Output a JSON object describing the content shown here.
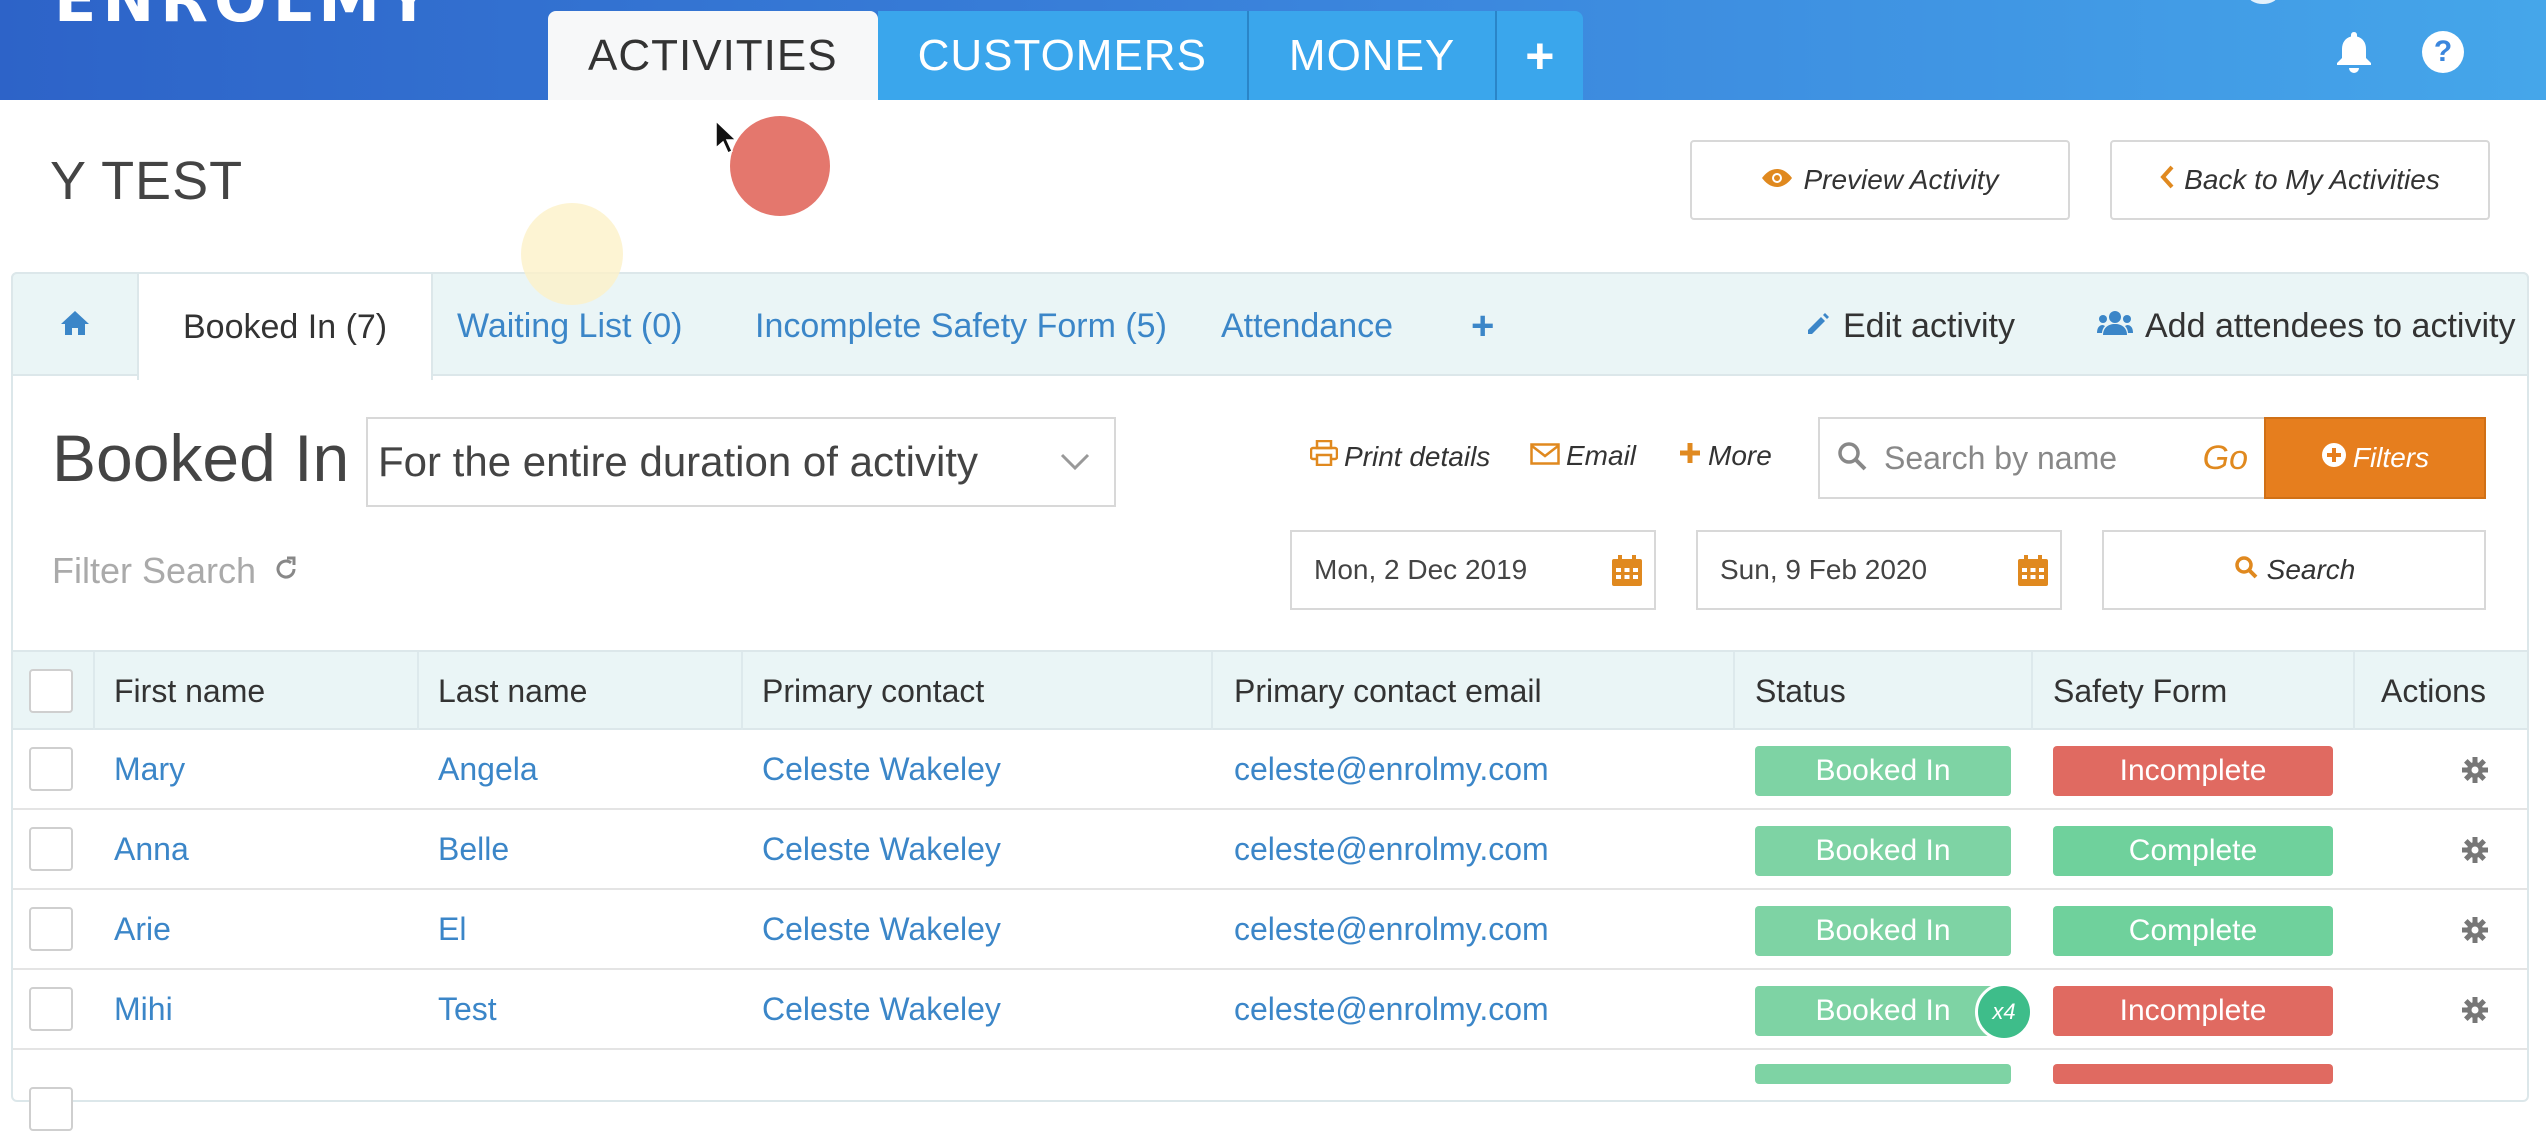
{
  "app": {
    "logo": "ENROLMY"
  },
  "nav": {
    "tabs": [
      {
        "label": "ACTIVITIES",
        "active": true
      },
      {
        "label": "CUSTOMERS",
        "active": false
      },
      {
        "label": "MONEY",
        "active": false
      }
    ],
    "plus_label": "+",
    "icons": [
      "bell-icon",
      "help-icon"
    ],
    "help_label": "?"
  },
  "page": {
    "title": "Y TEST",
    "preview_label": "Preview Activity",
    "back_label": "Back to My Activities"
  },
  "subtabs": {
    "items": [
      {
        "label": "Booked In (7)",
        "active": true
      },
      {
        "label": "Waiting List (0)",
        "active": false
      },
      {
        "label": "Incomplete Safety Form (5)",
        "active": false
      },
      {
        "label": "Attendance",
        "active": false
      }
    ],
    "add_label": "+",
    "edit_label": "Edit activity",
    "add_attendees_label": "Add attendees to activity"
  },
  "toolbar": {
    "section_title": "Booked In",
    "duration_value": "For the entire duration of activity",
    "print_label": "Print details",
    "email_label": "Email",
    "more_label": "More",
    "search_placeholder": "Search by name",
    "go_label": "Go",
    "filters_label": "Filters",
    "filter_search_label": "Filter Search",
    "start_date": "Mon, 2 Dec 2019",
    "end_date": "Sun, 9 Feb 2020",
    "search_button_label": "Search"
  },
  "table": {
    "columns": [
      "First name",
      "Last name",
      "Primary contact",
      "Primary contact email",
      "Status",
      "Safety Form",
      "Actions"
    ],
    "rows": [
      {
        "first": "Mary",
        "last": "Angela",
        "contact": "Celeste Wakeley",
        "email": "celeste@enrolmy.com",
        "status": "Booked In",
        "safety": "Incomplete"
      },
      {
        "first": "Anna",
        "last": "Belle",
        "contact": "Celeste Wakeley",
        "email": "celeste@enrolmy.com",
        "status": "Booked In",
        "safety": "Complete"
      },
      {
        "first": "Arie",
        "last": "El",
        "contact": "Celeste Wakeley",
        "email": "celeste@enrolmy.com",
        "status": "Booked In",
        "safety": "Complete"
      },
      {
        "first": "Mihi",
        "last": "Test",
        "contact": "Celeste Wakeley",
        "email": "celeste@enrolmy.com",
        "status": "Booked In",
        "safety": "Incomplete"
      }
    ],
    "status_count_badge": "x4"
  },
  "colors": {
    "nav_blue": "#3aa6ec",
    "accent_orange": "#e67e1e",
    "link_blue": "#3b86c8",
    "status_green": "#7ed3a4",
    "complete_green": "#6fd19c",
    "incomplete_red": "#e06a61"
  }
}
